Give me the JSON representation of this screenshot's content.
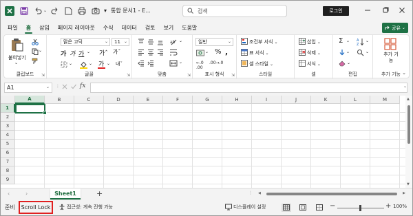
{
  "titlebar": {
    "doc_title": "통합 문서1 - E...",
    "search_placeholder": "검색",
    "login_label": "로그인"
  },
  "menu": {
    "tabs": [
      "파일",
      "홈",
      "삽입",
      "페이지 레이아웃",
      "수식",
      "데이터",
      "검토",
      "보기",
      "도움말"
    ],
    "active_tab": "홈",
    "share_label": "공유"
  },
  "ribbon": {
    "clipboard": {
      "paste_label": "붙여넣기",
      "group_label": "클립보드"
    },
    "font": {
      "font_name": "맑은 고딕",
      "font_size": "11",
      "group_label": "글꼴"
    },
    "alignment": {
      "group_label": "맞춤"
    },
    "number": {
      "format": "일반",
      "group_label": "표시 형식"
    },
    "styles": {
      "conditional_label": "조건부 서식",
      "table_label": "표 서식",
      "cell_style_label": "셀 스타일",
      "group_label": "스타일"
    },
    "cells": {
      "insert_label": "삽입",
      "delete_label": "삭제",
      "format_label": "서식",
      "group_label": "셀"
    },
    "editing": {
      "group_label": "편집"
    },
    "addins": {
      "label": "추가 기능",
      "group_label": "추가 기능"
    }
  },
  "formula_bar": {
    "name_box": "A1",
    "fx_label": "fx"
  },
  "grid": {
    "columns": [
      "A",
      "B",
      "C",
      "D",
      "E",
      "F",
      "G",
      "H",
      "I",
      "J",
      "K",
      "L",
      "M"
    ],
    "rows": [
      "1",
      "2",
      "3",
      "4",
      "5",
      "6",
      "7",
      "8",
      "9"
    ],
    "selected_column": "A",
    "selected_row": "1"
  },
  "sheets": {
    "tabs": [
      "Sheet1"
    ],
    "add_label": "+"
  },
  "statusbar": {
    "ready_label": "준비",
    "scroll_lock_label": "Scroll Lock",
    "accessibility_label": "접근성: 계속 진행 가능",
    "display_settings_label": "디스플레이 설정",
    "zoom_label": "100%"
  },
  "colors": {
    "accent": "#1e7145",
    "highlight_box": "#e02020"
  }
}
